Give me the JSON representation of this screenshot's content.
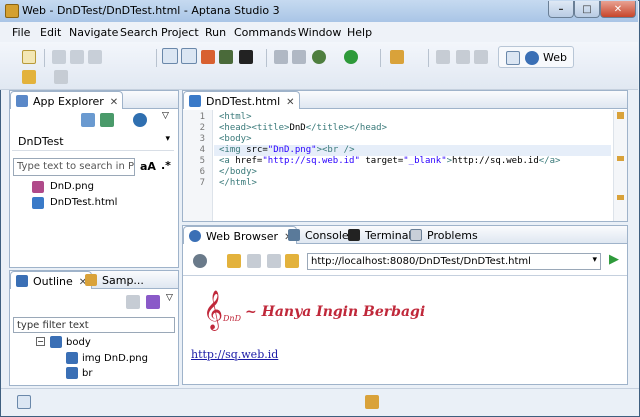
{
  "window": {
    "title": "Web - DnDTest/DnDTest.html - Aptana Studio 3"
  },
  "menu": [
    "File",
    "Edit",
    "Navigate",
    "Search",
    "Project",
    "Run",
    "Commands",
    "Window",
    "Help"
  ],
  "perspective": {
    "label": "Web"
  },
  "app_explorer": {
    "tab_label": "App Explorer",
    "project": "DnDTest",
    "filter_placeholder": "Type text to search in Pro",
    "font_toggle": "aA",
    "regex_toggle": ".*",
    "files": [
      "DnD.png",
      "DnDTest.html"
    ]
  },
  "outline": {
    "tab_label": "Outline",
    "tab2_label": "Samp...",
    "filter_placeholder": "type filter text",
    "nodes": [
      {
        "label": "body",
        "indent": 0
      },
      {
        "label": "img DnD.png",
        "indent": 1
      },
      {
        "label": "br",
        "indent": 1
      }
    ]
  },
  "editor": {
    "tab_label": "DnDTest.html",
    "lines": [
      {
        "n": "1",
        "text": "<html>"
      },
      {
        "n": "2",
        "text": "<head><title>DnD</title></head>"
      },
      {
        "n": "3",
        "text": "<body>"
      },
      {
        "n": "4",
        "text": "<img src=\"DnD.png\"><br />"
      },
      {
        "n": "5",
        "text": "<a href=\"http://sq.web.id\" target=\"_blank\">http://sq.web.id</a>"
      },
      {
        "n": "6",
        "text": "</body>"
      },
      {
        "n": "7",
        "text": "</html>"
      }
    ]
  },
  "bottom_tabs": [
    "Web Browser",
    "Console",
    "Terminal",
    "Problems"
  ],
  "browser": {
    "url": "http://localhost:8080/DnDTest/DnDTest.html",
    "logo_text": "~ Hanya Ingin Berbagi",
    "logo_small": "DnD",
    "link": "http://sq.web.id"
  },
  "colors": {
    "logo_red": "#c0283a",
    "link_blue": "#1a1aa6"
  }
}
